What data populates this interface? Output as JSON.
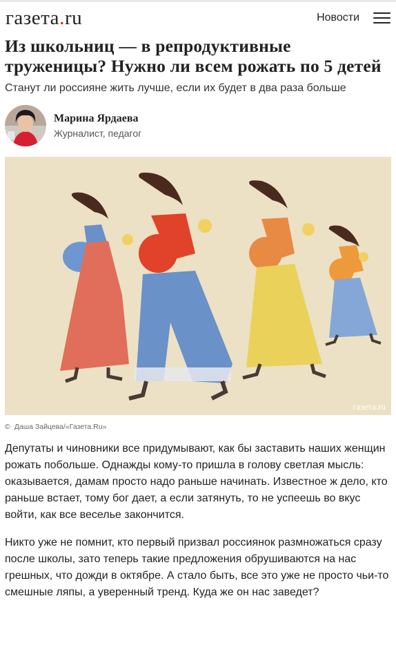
{
  "header": {
    "logo_main": "газета",
    "logo_dot": ".",
    "logo_tld": "ru",
    "nav_link": "Новости",
    "menu_icon": "hamburger-menu-icon"
  },
  "article": {
    "title": "Из школьниц — в репродуктивные труженицы? Нужно ли всем рожать по 5 детей",
    "subtitle": "Станут ли россияне жить лучше, если их будет в два раза больше",
    "author": {
      "name": "Марина Ярдаева",
      "role": "Журналист, педагог"
    },
    "image": {
      "watermark": "газета.ru",
      "copyright_symbol": "©",
      "credit": "Даша Зайцева/«Газета.Ru»"
    },
    "paragraphs": [
      "Депутаты и чиновники все придумывают, как бы заставить наших женщин рожать побольше. Однажды кому-то пришла в голову светлая мысль: оказывается, дамам просто надо раньше начинать. Известное ж дело, кто раньше встает, тому бог дает, а если затянуть, то не успеешь во вкус войти, как все веселье закончится.",
      "Никто уже не помнит, кто первый призвал россиянок размножаться сразу после школы, зато теперь такие предложения обрушиваются на нас грешных, что дожди в октябре. А стало быть, все это уже не просто чьи-то смешные ляпы, а уверенный тренд. Куда же он нас заведет?"
    ]
  },
  "colors": {
    "accent": "#e2231a",
    "image_background": "#ece1c4"
  }
}
